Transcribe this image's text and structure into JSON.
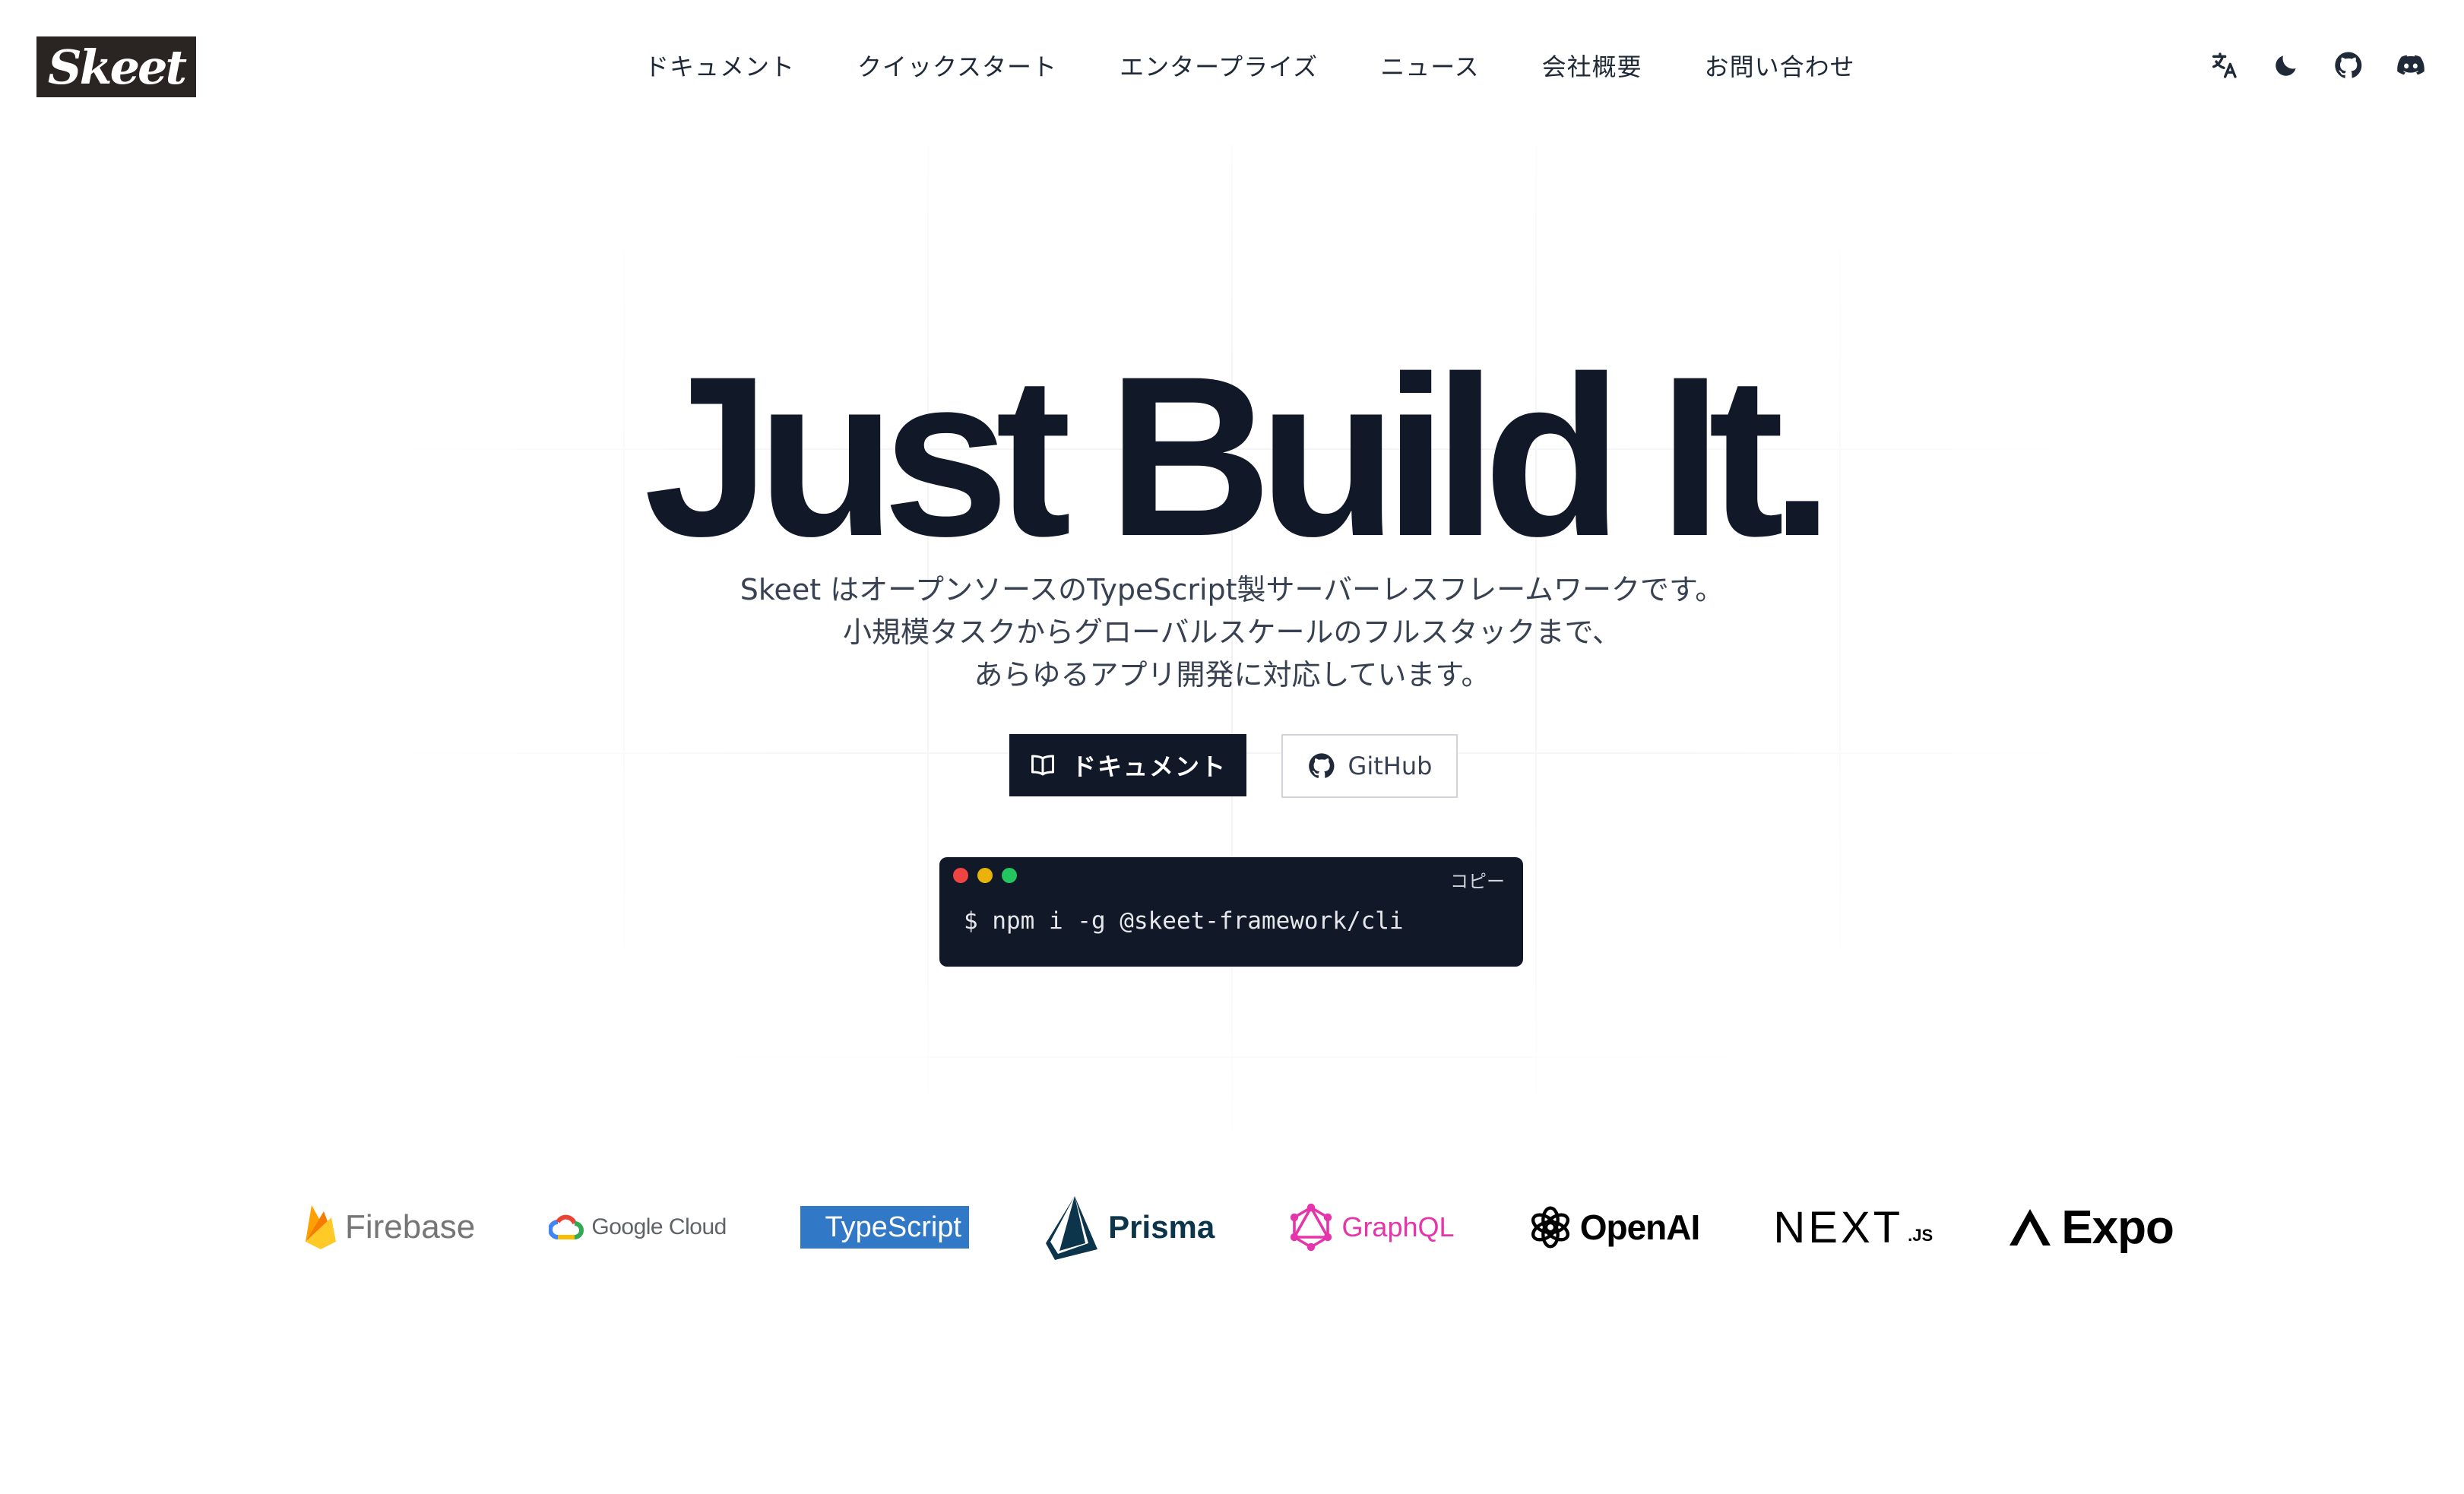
{
  "header": {
    "logo_text": "Skeet",
    "nav": [
      "ドキュメント",
      "クイックスタート",
      "エンタープライズ",
      "ニュース",
      "会社概要",
      "お問い合わせ"
    ],
    "icons": [
      "translate-icon",
      "moon-icon",
      "github-icon",
      "discord-icon"
    ]
  },
  "hero": {
    "title": "Just Build It.",
    "description": [
      "Skeet はオープンソースのTypeScript製サーバーレスフレームワークです。",
      "小規模タスクからグローバルスケールのフルスタックまで、",
      "あらゆるアプリ開発に対応しています。"
    ],
    "primary_button": "ドキュメント",
    "secondary_button": "GitHub"
  },
  "terminal": {
    "copy_label": "コピー",
    "command": "$ npm i -g @skeet-framework/cli",
    "dot_colors": [
      "#ef4444",
      "#eab308",
      "#22c55e"
    ]
  },
  "brands": {
    "firebase": "Firebase",
    "google_cloud": "Google Cloud",
    "typescript": "TypeScript",
    "prisma": "Prisma",
    "graphql": "GraphQL",
    "openai": "OpenAI",
    "nextjs": "NEXT",
    "nextjs_suffix": ".JS",
    "expo": "Expo"
  },
  "colors": {
    "primary": "#111827",
    "text": "#1f2937",
    "graphql": "#e535ab",
    "typescript": "#3178c6",
    "prisma": "#0c344b"
  }
}
